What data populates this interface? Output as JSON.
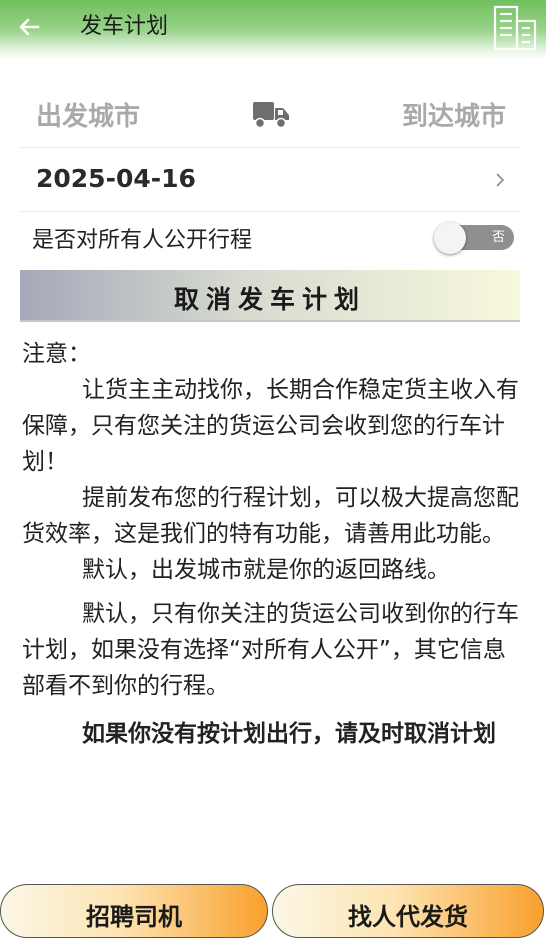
{
  "header": {
    "title": "发车计划",
    "back_icon": "arrow-left-icon",
    "building_icon": "building-icon",
    "colors": {
      "gradient_top": "#6fc05c",
      "gradient_bottom": "#ffffff"
    }
  },
  "route": {
    "from_label": "出发城市",
    "to_label": "到达城市",
    "icon": "truck-icon"
  },
  "date": {
    "value": "2025-04-16",
    "icon": "chevron-right-icon"
  },
  "public_trip": {
    "label": "是否对所有人公开行程",
    "toggle_text": "否",
    "enabled": false
  },
  "cancel_button": {
    "label": "取消发车计划"
  },
  "notice": {
    "heading": "注意：",
    "paragraphs": [
      "让货主主动找你，长期合作稳定货主收入有保障，只有您关注的货运公司会收到您的行车计划！",
      "提前发布您的行程计划，可以极大提高您配货效率，这是我们的特有功能，请善用此功能。",
      "默认，出发城市就是你的返回路线。",
      "默认，只有你关注的货运公司收到你的行车计划，如果没有选择“对所有人公开”，其它信息部看不到你的行程。"
    ],
    "emphasis": "如果你没有按计划出行，请及时取消计划"
  },
  "bottom_buttons": {
    "recruit_label": "招聘司机",
    "ship_label": "找人代发货",
    "colors": {
      "start": "#fbf7e6",
      "end": "#f9a02d"
    }
  }
}
